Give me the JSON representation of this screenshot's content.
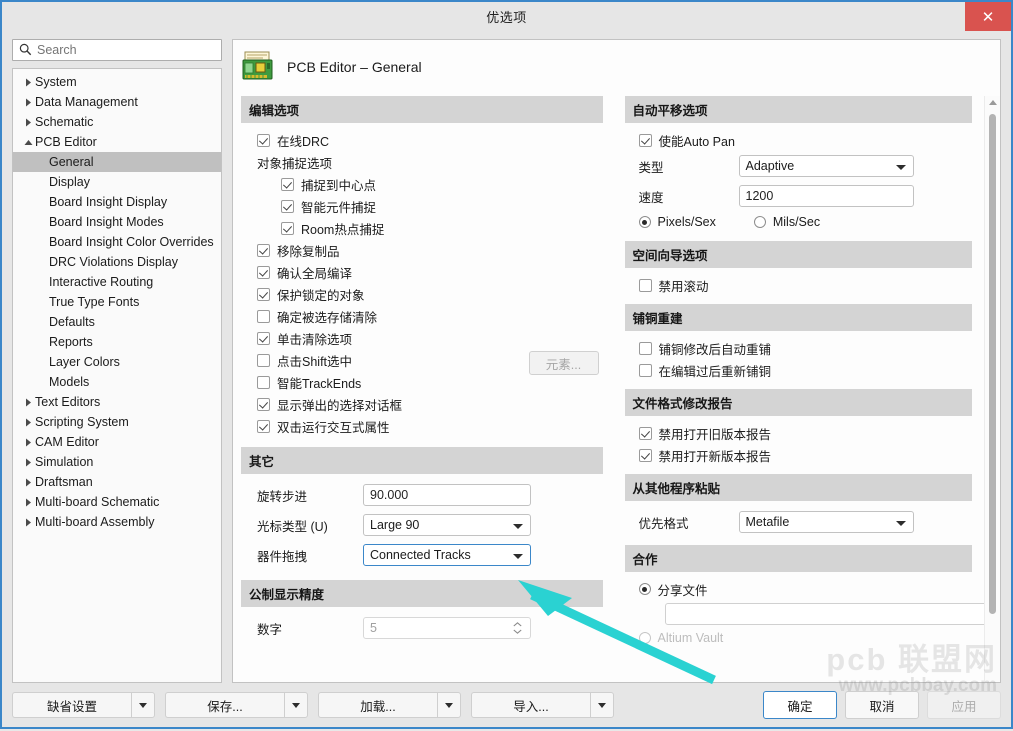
{
  "window": {
    "title": "优选项",
    "close_label": "✕"
  },
  "search": {
    "placeholder": "Search",
    "value": "",
    "icon": "search-icon"
  },
  "nav": {
    "items": [
      {
        "label": "System",
        "level": 0,
        "expander": "collapsed",
        "selected": false
      },
      {
        "label": "Data Management",
        "level": 0,
        "expander": "collapsed",
        "selected": false
      },
      {
        "label": "Schematic",
        "level": 0,
        "expander": "collapsed",
        "selected": false
      },
      {
        "label": "PCB Editor",
        "level": 0,
        "expander": "expanded",
        "selected": false
      },
      {
        "label": "General",
        "level": 1,
        "expander": "none",
        "selected": true
      },
      {
        "label": "Display",
        "level": 1,
        "expander": "none",
        "selected": false
      },
      {
        "label": "Board Insight Display",
        "level": 1,
        "expander": "none",
        "selected": false
      },
      {
        "label": "Board Insight Modes",
        "level": 1,
        "expander": "none",
        "selected": false
      },
      {
        "label": "Board Insight Color Overrides",
        "level": 1,
        "expander": "none",
        "selected": false
      },
      {
        "label": "DRC Violations Display",
        "level": 1,
        "expander": "none",
        "selected": false
      },
      {
        "label": "Interactive Routing",
        "level": 1,
        "expander": "none",
        "selected": false
      },
      {
        "label": "True Type Fonts",
        "level": 1,
        "expander": "none",
        "selected": false
      },
      {
        "label": "Defaults",
        "level": 1,
        "expander": "none",
        "selected": false
      },
      {
        "label": "Reports",
        "level": 1,
        "expander": "none",
        "selected": false
      },
      {
        "label": "Layer Colors",
        "level": 1,
        "expander": "none",
        "selected": false
      },
      {
        "label": "Models",
        "level": 1,
        "expander": "none",
        "selected": false
      },
      {
        "label": "Text Editors",
        "level": 0,
        "expander": "collapsed",
        "selected": false
      },
      {
        "label": "Scripting System",
        "level": 0,
        "expander": "collapsed",
        "selected": false
      },
      {
        "label": "CAM Editor",
        "level": 0,
        "expander": "collapsed",
        "selected": false
      },
      {
        "label": "Simulation",
        "level": 0,
        "expander": "collapsed",
        "selected": false
      },
      {
        "label": "Draftsman",
        "level": 0,
        "expander": "collapsed",
        "selected": false
      },
      {
        "label": "Multi-board Schematic",
        "level": 0,
        "expander": "collapsed",
        "selected": false
      },
      {
        "label": "Multi-board Assembly",
        "level": 0,
        "expander": "collapsed",
        "selected": false
      }
    ]
  },
  "page": {
    "title": "PCB Editor – General",
    "icon": "pcb-board-icon"
  },
  "left_column": {
    "editing_options": {
      "heading": "编辑选项",
      "online_drc": {
        "label": "在线DRC",
        "checked": true
      },
      "snap_group_label": "对象捕捉选项",
      "snap_items": [
        {
          "label": "捕捉到中心点",
          "checked": true
        },
        {
          "label": "智能元件捕捉",
          "checked": true
        },
        {
          "label": "Room热点捕捉",
          "checked": true
        }
      ],
      "items": [
        {
          "label": "移除复制品",
          "checked": true
        },
        {
          "label": "确认全局编译",
          "checked": true
        },
        {
          "label": "保护锁定的对象",
          "checked": true
        },
        {
          "label": "确定被选存储清除",
          "checked": false
        },
        {
          "label": "单击清除选项",
          "checked": true
        },
        {
          "label": "点击Shift选中",
          "checked": false
        },
        {
          "label": "智能TrackEnds",
          "checked": false
        },
        {
          "label": "显示弹出的选择对话框",
          "checked": true
        },
        {
          "label": "双击运行交互式属性",
          "checked": true
        }
      ],
      "primitives_button": "元素..."
    },
    "other": {
      "heading": "其它",
      "rotation_step": {
        "label": "旋转步进",
        "value": "90.000"
      },
      "cursor_type": {
        "label": "光标类型 (U)",
        "value": "Large 90"
      },
      "comp_drag": {
        "label": "器件拖拽",
        "value": "Connected Tracks",
        "focused": true
      }
    },
    "metric_precision": {
      "heading": "公制显示精度",
      "digits": {
        "label": "数字",
        "value": "5",
        "disabled": true
      }
    }
  },
  "right_column": {
    "autopan": {
      "heading": "自动平移选项",
      "enable": {
        "label": "使能Auto Pan",
        "checked": true
      },
      "style": {
        "label": "类型",
        "value": "Adaptive"
      },
      "speed": {
        "label": "速度",
        "value": "1200"
      },
      "units": [
        {
          "label": "Pixels/Sex",
          "selected": true
        },
        {
          "label": "Mils/Sec",
          "selected": false
        }
      ]
    },
    "space_navigator": {
      "heading": "空间向导选项",
      "disable_roll": {
        "label": "禁用滚动",
        "checked": false
      }
    },
    "polygon_rebuild": {
      "heading": "铺铜重建",
      "items": [
        {
          "label": "铺铜修改后自动重铺",
          "checked": false
        },
        {
          "label": "在编辑过后重新铺铜",
          "checked": false
        }
      ]
    },
    "file_format_report": {
      "heading": "文件格式修改报告",
      "items": [
        {
          "label": "禁用打开旧版本报告",
          "checked": true
        },
        {
          "label": "禁用打开新版本报告",
          "checked": true
        }
      ]
    },
    "paste_from_other": {
      "heading": "从其他程序粘贴",
      "priority_format": {
        "label": "优先格式",
        "value": "Metafile"
      }
    },
    "collaboration": {
      "heading": "合作",
      "shared_file": {
        "label": "分享文件",
        "selected": true
      },
      "shared_path": {
        "value": "",
        "browse_icon": "folder-open-icon"
      },
      "altium_vault": {
        "label": "Altium Vault",
        "selected": false,
        "disabled": true
      }
    }
  },
  "footer": {
    "left_buttons": [
      {
        "label": "缺省设置"
      },
      {
        "label": "保存..."
      },
      {
        "label": "加载..."
      },
      {
        "label": "导入..."
      }
    ],
    "ok": "确定",
    "cancel": "取消",
    "apply": "应用"
  },
  "watermark": {
    "line1": "pcb 联盟网",
    "line2": "www.pcbbay.com"
  },
  "colors": {
    "accent": "#3b87c9",
    "close": "#d9534f",
    "group_head": "#d4d4d4",
    "annotation_arrow": "#2ad2d2"
  }
}
